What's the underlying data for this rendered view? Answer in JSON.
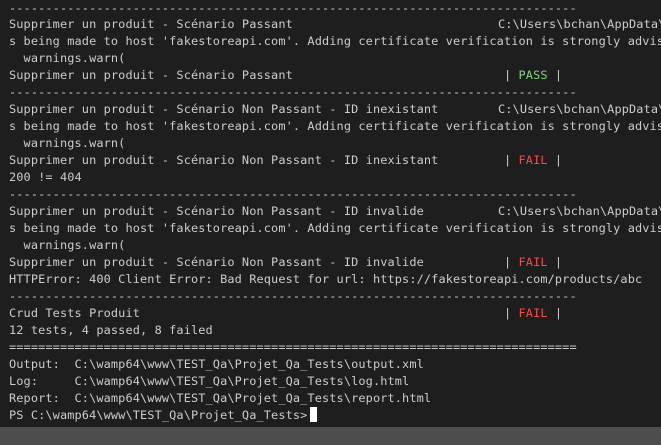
{
  "terminal": {
    "lines": [
      {
        "text": "------------------------------------------------------------------------------"
      },
      {
        "text": "Supprimer un produit - Scénario Passant",
        "path": "C:\\Users\\bchan\\AppData\\"
      },
      {
        "text": "s being made to host 'fakestoreapi.com'. Adding certificate verification is strongly advised."
      },
      {
        "text": "  warnings.warn("
      },
      {
        "text": "Supprimer un produit - Scénario Passant                             | ",
        "status": "PASS",
        "tail": " |"
      },
      {
        "text": "------------------------------------------------------------------------------"
      },
      {
        "text": "Supprimer un produit - Scénario Non Passant - ID inexistant",
        "path": "C:\\Users\\bchan\\AppData\\"
      },
      {
        "text": "s being made to host 'fakestoreapi.com'. Adding certificate verification is strongly advised."
      },
      {
        "text": "  warnings.warn("
      },
      {
        "text": "Supprimer un produit - Scénario Non Passant - ID inexistant         | ",
        "status": "FAIL",
        "tail": " |"
      },
      {
        "text": "200 != 404"
      },
      {
        "text": "------------------------------------------------------------------------------"
      },
      {
        "text": "Supprimer un produit - Scénario Non Passant - ID invalide",
        "path": "C:\\Users\\bchan\\AppData\\"
      },
      {
        "text": "s being made to host 'fakestoreapi.com'. Adding certificate verification is strongly advised."
      },
      {
        "text": "  warnings.warn("
      },
      {
        "text": "Supprimer un produit - Scénario Non Passant - ID invalide           | ",
        "status": "FAIL",
        "tail": " |"
      },
      {
        "text": "HTTPError: 400 Client Error: Bad Request for url: https://fakestoreapi.com/products/abc"
      },
      {
        "text": "------------------------------------------------------------------------------"
      },
      {
        "text": "Crud Tests Produit                                                  | ",
        "status": "FAIL",
        "tail": " |"
      },
      {
        "text": "12 tests, 4 passed, 8 failed"
      },
      {
        "text": "=============================================================================="
      },
      {
        "text": "Output:  C:\\wamp64\\www\\TEST_Qa\\Projet_Qa_Tests\\output.xml"
      },
      {
        "text": "Log:     C:\\wamp64\\www\\TEST_Qa\\Projet_Qa_Tests\\log.html"
      },
      {
        "text": "Report:  C:\\wamp64\\www\\TEST_Qa\\Projet_Qa_Tests\\report.html"
      },
      {
        "text": "PS C:\\wamp64\\www\\TEST_Qa\\Projet_Qa_Tests>",
        "prompt": true
      }
    ],
    "colors": {
      "background": "#1e1e1e",
      "text": "#cccccc",
      "pass": "#89d185",
      "fail": "#f14c4c"
    }
  }
}
